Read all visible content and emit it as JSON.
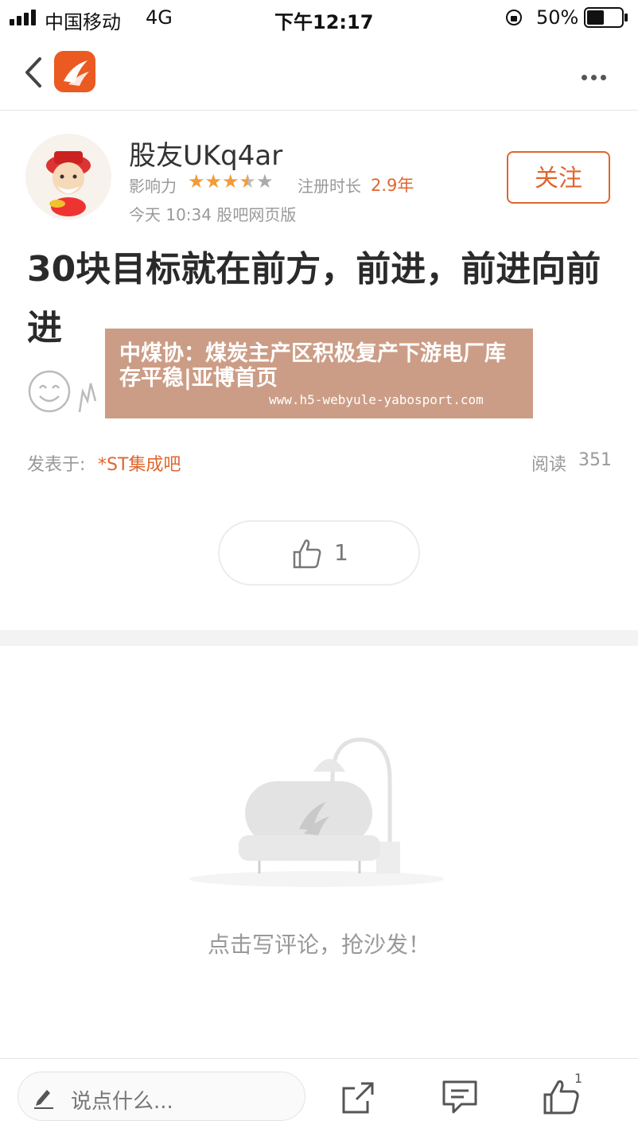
{
  "status_bar": {
    "carrier": "中国移动",
    "network": "4G",
    "time": "下午12:17",
    "battery": "50%"
  },
  "author": {
    "name": "股友UKq4ar",
    "influence_label": "影响力",
    "rating": 4.5,
    "reg_label": "注册时长",
    "reg_value": "2.9年",
    "meta": "今天 10:34 股吧网页版",
    "follow_label": "关注"
  },
  "post": {
    "title": "30块目标就在前方，前进，前进向前进",
    "posted_label": "发表于:",
    "forum": "*ST集成吧",
    "read_label": "阅读",
    "read_count": "351",
    "like_count": "1"
  },
  "overlay": {
    "headline": "中煤协：煤炭主产区积极复产下游电厂库存平稳|亚博首页",
    "url": "www.h5-webyule-yabosport.com"
  },
  "empty_comments": {
    "text": "点击写评论，抢沙发！"
  },
  "bottom_bar": {
    "placeholder": "说点什么...",
    "like_badge": "1"
  },
  "colors": {
    "accent": "#e0662e",
    "star": "#f29b38"
  }
}
